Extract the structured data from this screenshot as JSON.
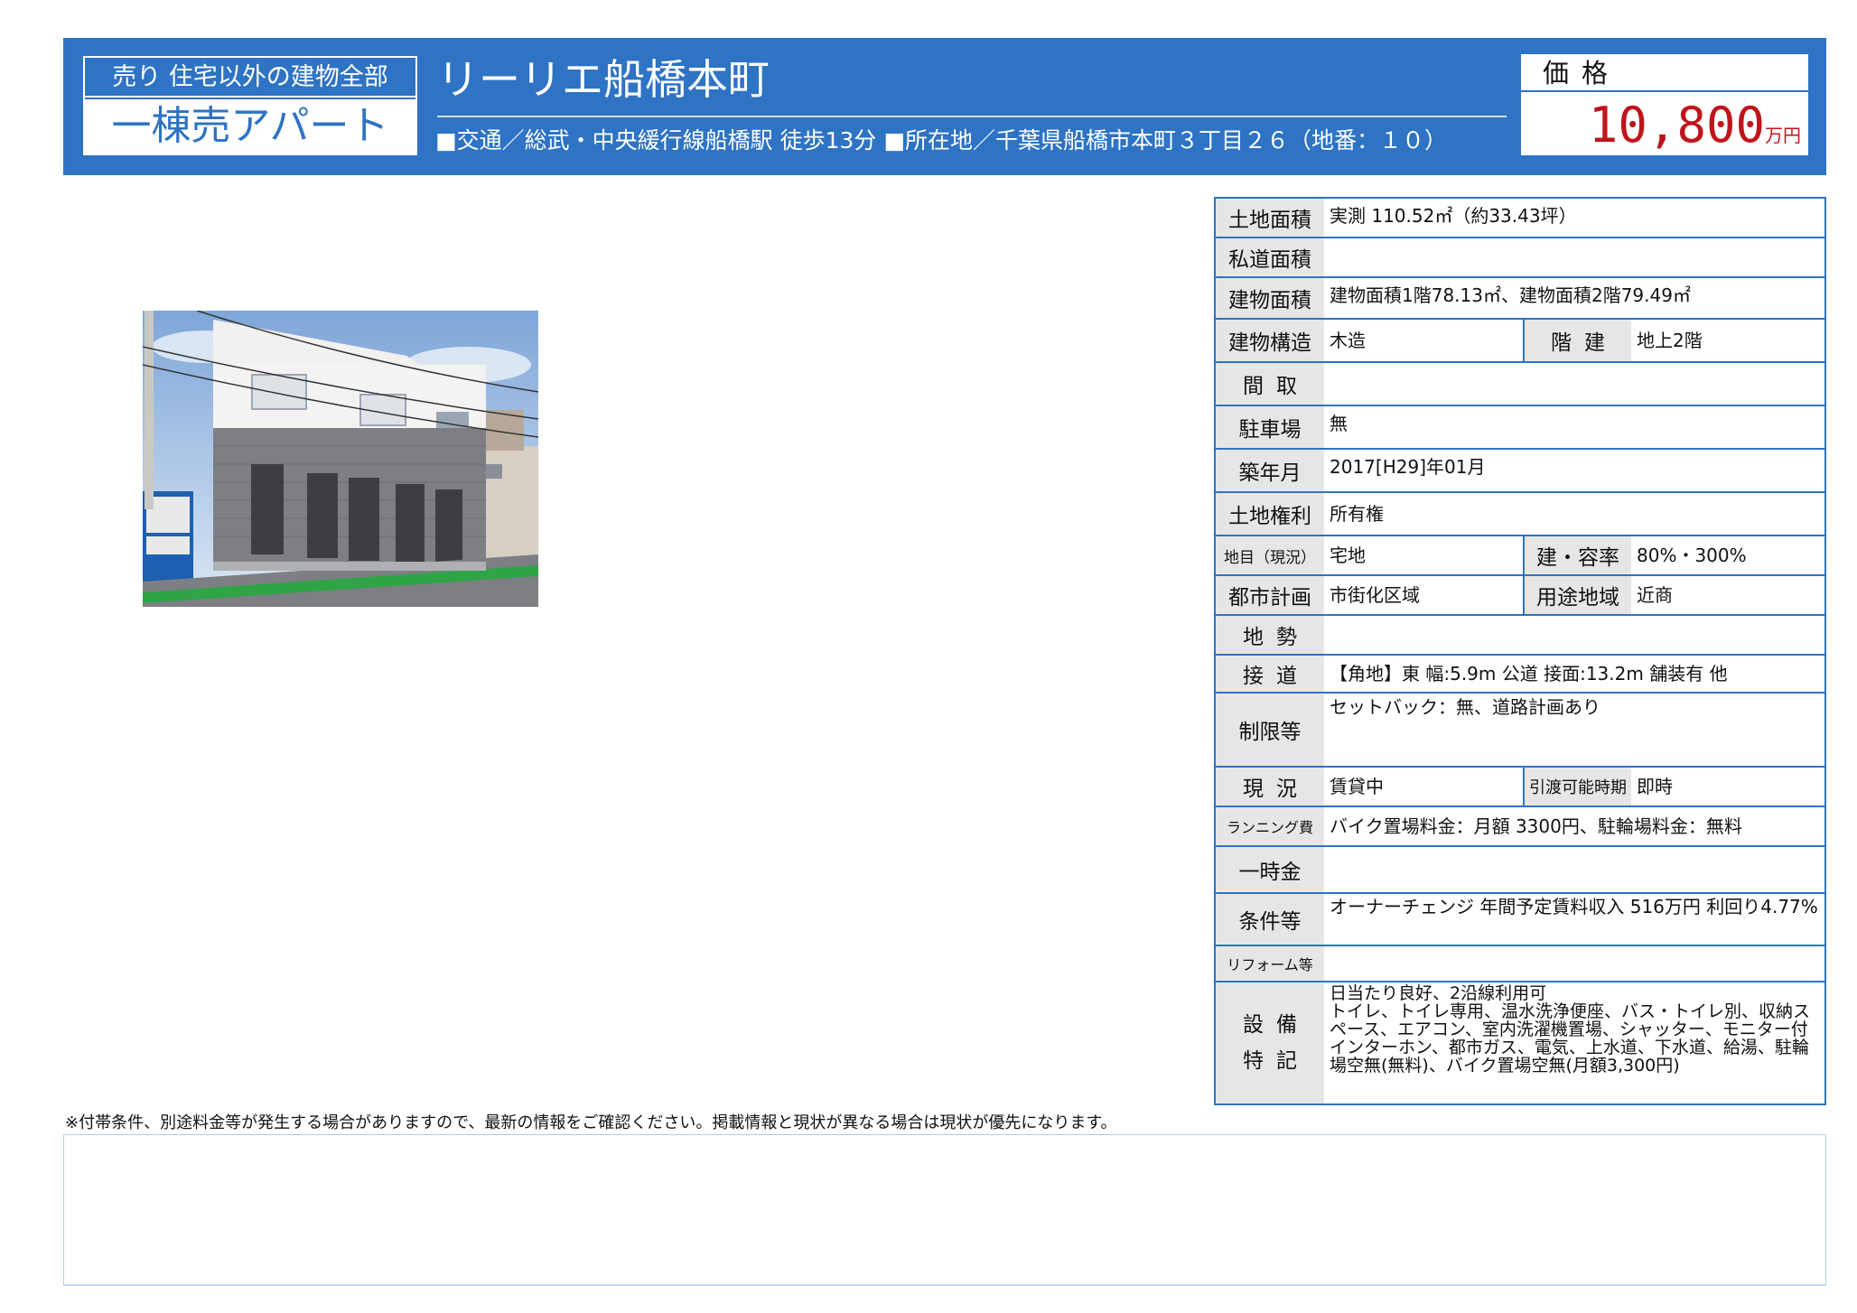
{
  "header": {
    "category_top": "売り 住宅以外の建物全部",
    "category_bottom": "一棟売アパート",
    "property_name": "リーリエ船橋本町",
    "access_line": "■交通／総武・中央緩行線船橋駅 徒歩13分 ■所在地／千葉県船橋市本町３丁目２６（地番：１０）",
    "price_label": "価格",
    "price_value": "10,800",
    "price_unit": "万円",
    "brand_color": "#2e73c4",
    "price_color": "#c0141b"
  },
  "photo": {
    "icon": "building-photo"
  },
  "spec": {
    "land_area": {
      "label": "土地面積",
      "value": "実測 110.52㎡（約33.43坪）"
    },
    "private_road_area": {
      "label": "私道面積",
      "value": ""
    },
    "building_area": {
      "label": "建物面積",
      "value": "建物面積1階78.13㎡、建物面積2階79.49㎡"
    },
    "structure": {
      "label": "建物構造",
      "value": "木造",
      "floors_label": "階建",
      "floors_value": "地上2階"
    },
    "layout": {
      "label": "間取",
      "value": ""
    },
    "parking": {
      "label": "駐車場",
      "value": "無"
    },
    "built": {
      "label": "築年月",
      "value": "2017[H29]年01月"
    },
    "land_rights": {
      "label": "土地権利",
      "value": "所有権"
    },
    "land_category": {
      "label": "地目（現況）",
      "value": "宅地",
      "ratio_label": "建・容率",
      "ratio_value": "80%・300%"
    },
    "city_planning": {
      "label": "都市計画",
      "value": "市街化区域",
      "zoning_label": "用途地域",
      "zoning_value": "近商"
    },
    "terrain": {
      "label": "地勢",
      "value": ""
    },
    "road_access": {
      "label": "接道",
      "value": "【角地】東 幅:5.9m 公道 接面:13.2m 舗装有 他"
    },
    "restrictions": {
      "label": "制限等",
      "value": "セットバック：無、道路計画あり"
    },
    "status": {
      "label": "現況",
      "value": "賃貸中",
      "handover_label": "引渡可能時期",
      "handover_value": "即時"
    },
    "running_cost": {
      "label": "ランニング費",
      "value": "バイク置場料金：月額 3300円、駐輪場料金：無料"
    },
    "one_time": {
      "label": "一時金",
      "value": ""
    },
    "conditions": {
      "label": "条件等",
      "value": "オーナーチェンジ 年間予定賃料収入 516万円 利回り4.77%"
    },
    "reform": {
      "label": "リフォーム等",
      "value": ""
    },
    "facilities": {
      "label_line1": "設備",
      "label_line2": "特記",
      "value": "日当たり良好、2沿線利用可\nトイレ、トイレ専用、温水洗浄便座、バス・トイレ別、収納スペース、エアコン、室内洗濯機置場、シャッター、モニター付インターホン、都市ガス、電気、上水道、下水道、給湯、駐輪場空無(無料)、バイク置場空無(月額3,300円)"
    }
  },
  "footer": {
    "disclaimer": "※付帯条件、別途料金等が発生する場合がありますので、最新の情報をご確認ください。掲載情報と現状が異なる場合は現状が優先になります。",
    "notes": ""
  }
}
